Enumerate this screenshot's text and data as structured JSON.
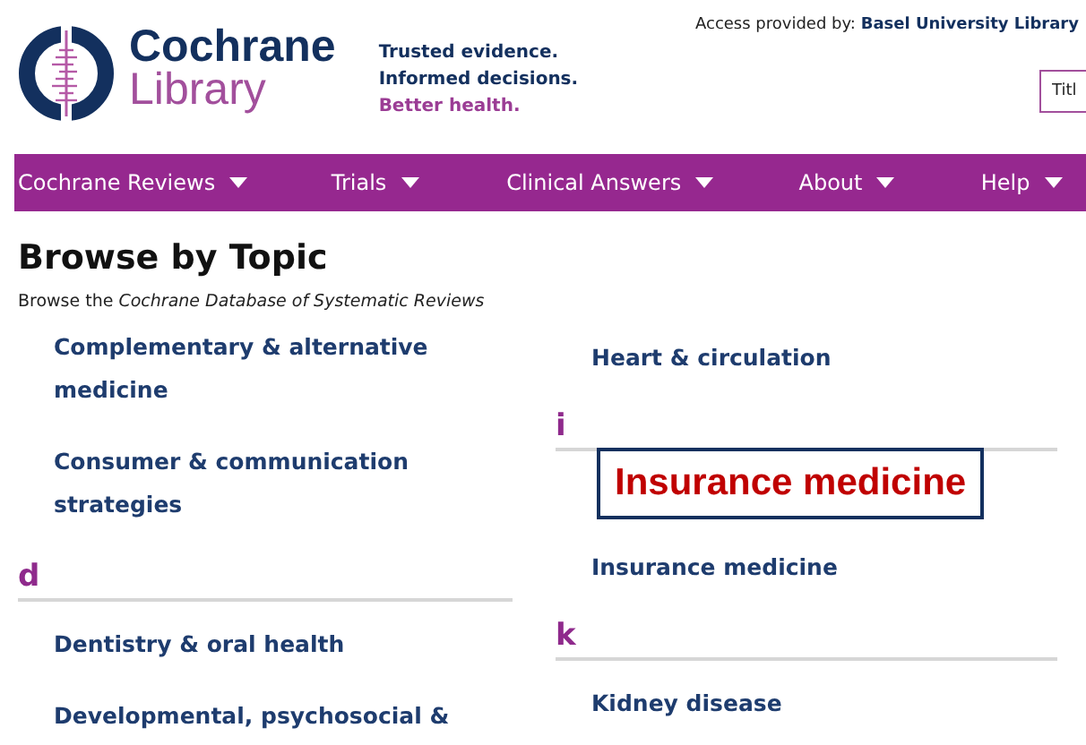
{
  "header": {
    "logo_line_1": "Cochrane",
    "logo_line_2": "Library",
    "tagline": [
      "Trusted evidence.",
      "Informed decisions.",
      "Better health."
    ],
    "access_label": "Access provided by:",
    "access_org": "Basel University Library",
    "search_field": {
      "value": "Titl"
    }
  },
  "nav": [
    {
      "label": "Cochrane Reviews"
    },
    {
      "label": "Trials"
    },
    {
      "label": "Clinical Answers"
    },
    {
      "label": "About"
    },
    {
      "label": "Help"
    }
  ],
  "page": {
    "title": "Browse by Topic",
    "subtitle_prefix": "Browse the",
    "subtitle_link": "Cochrane Database of Systematic Reviews"
  },
  "columns": [
    {
      "sections": [
        {
          "topics": [
            "Complementary & alternative medicine",
            "Consumer & communication strategies"
          ]
        },
        {
          "letter": "d",
          "topics": [
            "Dentistry & oral health",
            "Developmental, psychosocial &"
          ]
        }
      ]
    },
    {
      "sections": [
        {
          "topics": [
            "Heart & circulation"
          ]
        },
        {
          "letter": "i",
          "topics": [
            "Insurance medicine"
          ]
        },
        {
          "letter": "k",
          "topics": [
            "Kidney disease"
          ]
        }
      ]
    }
  ],
  "callout": {
    "text": "Insurance medicine"
  }
}
